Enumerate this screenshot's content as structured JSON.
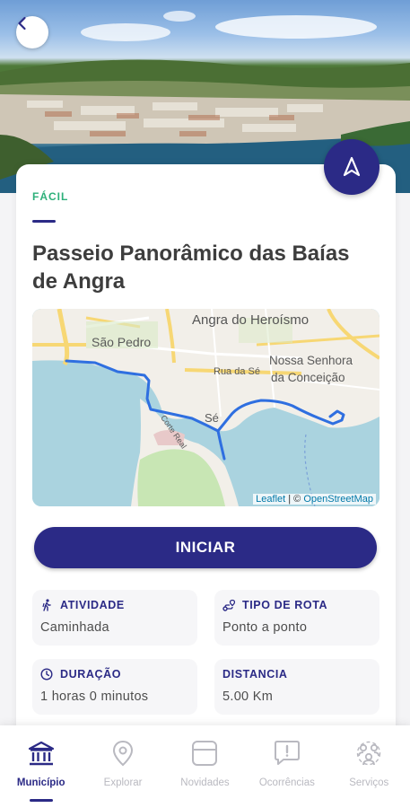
{
  "route": {
    "difficulty": "FÁCIL",
    "title": "Passeio Panorâmico das Baías de Angra"
  },
  "map": {
    "labels": {
      "town": "Angra do Heroísmo",
      "sao_pedro": "São Pedro",
      "rua_da_se": "Rua da Sé",
      "nossa_senhora": "Nossa Senhora",
      "da_conceicao": "da Conceição",
      "se": "Sé",
      "corte_real": "Corte Real"
    },
    "attribution": {
      "leaflet": "Leaflet",
      "separator": " | © ",
      "osm": "OpenStreetMap"
    }
  },
  "actions": {
    "start_label": "INICIAR"
  },
  "info": {
    "activity": {
      "label": "ATIVIDADE",
      "value": "Caminhada",
      "icon": "hiker-icon"
    },
    "route_type": {
      "label": "TIPO DE ROTA",
      "value": "Ponto a ponto",
      "icon": "route-icon"
    },
    "duration": {
      "label": "DURAÇÃO",
      "value": "1 horas 0 minutos",
      "icon": "clock-icon"
    },
    "distance": {
      "label": "DISTANCIA",
      "value": "5.00 Km"
    }
  },
  "bottom_nav": {
    "items": [
      {
        "label": "Município",
        "icon": "municipality-icon",
        "active": true
      },
      {
        "label": "Explorar",
        "icon": "location-pin-icon",
        "active": false
      },
      {
        "label": "Novidades",
        "icon": "news-card-icon",
        "active": false
      },
      {
        "label": "Ocorrências",
        "icon": "alert-chat-icon",
        "active": false
      },
      {
        "label": "Serviços",
        "icon": "services-people-icon",
        "active": false
      }
    ]
  },
  "colors": {
    "primary": "#2b2a86",
    "difficulty_green": "#2db07a",
    "route_line": "#2f6fe0",
    "nav_inactive": "#b9b9c0"
  }
}
